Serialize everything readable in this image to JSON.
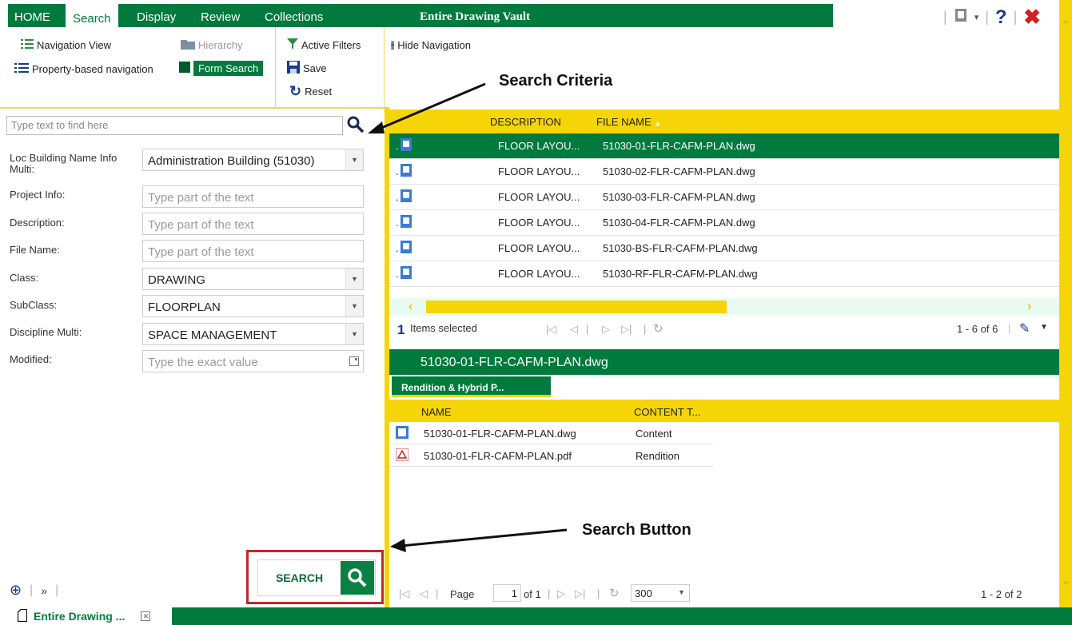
{
  "tabs": [
    "HOME",
    "Search",
    "Display",
    "Review",
    "Collections"
  ],
  "vault_title": "Entire Drawing Vault",
  "ribbon": {
    "navigation_view": "Navigation View",
    "hierarchy": "Hierarchy",
    "property_nav": "Property-based navigation",
    "form_search": "Form Search",
    "active_filters": "Active Filters",
    "save": "Save",
    "reset": "Reset",
    "hide_navigation": "Hide Navigation"
  },
  "search": {
    "placeholder": "Type text to find here",
    "button_label": "SEARCH"
  },
  "form": {
    "loc_label": "Loc Building Name Info Multi:",
    "loc_value": "Administration Building (51030)",
    "project_label": "Project Info:",
    "project_ph": "Type part of the text",
    "description_label": "Description:",
    "description_ph": "Type part of the text",
    "filename_label": "File Name:",
    "filename_ph": "Type part of the text",
    "class_label": "Class:",
    "class_value": "DRAWING",
    "subclass_label": "SubClass:",
    "subclass_value": "FLOORPLAN",
    "discipline_label": "Discipline Multi:",
    "discipline_value": "SPACE MANAGEMENT",
    "modified_label": "Modified:",
    "modified_ph": "Type the exact value"
  },
  "grid": {
    "col_description": "DESCRIPTION",
    "col_filename": "FILE NAME",
    "rows": [
      {
        "desc": "FLOOR LAYOU...",
        "file": "51030-01-FLR-CAFM-PLAN.dwg"
      },
      {
        "desc": "FLOOR LAYOU...",
        "file": "51030-02-FLR-CAFM-PLAN.dwg"
      },
      {
        "desc": "FLOOR LAYOU...",
        "file": "51030-03-FLR-CAFM-PLAN.dwg"
      },
      {
        "desc": "FLOOR LAYOU...",
        "file": "51030-04-FLR-CAFM-PLAN.dwg"
      },
      {
        "desc": "FLOOR LAYOU...",
        "file": "51030-BS-FLR-CAFM-PLAN.dwg"
      },
      {
        "desc": "FLOOR LAYOU...",
        "file": "51030-RF-FLR-CAFM-PLAN.dwg"
      }
    ],
    "selected_count": "1",
    "selected_text": "Items selected",
    "range": "1 - 6 of 6"
  },
  "detail": {
    "title": "51030-01-FLR-CAFM-PLAN.dwg",
    "tab": "Rendition & Hybrid P...",
    "col_name": "NAME",
    "col_content": "CONTENT T...",
    "rows": [
      {
        "name": "51030-01-FLR-CAFM-PLAN.dwg",
        "type": "Content"
      },
      {
        "name": "51030-01-FLR-CAFM-PLAN.pdf",
        "type": "Rendition"
      }
    ]
  },
  "pager": {
    "page_label": "Page",
    "page_value": "1",
    "of_label": "of 1",
    "page_size": "300",
    "range": "1 - 2 of 2"
  },
  "status_tab": "Entire Drawing ...",
  "annotations": {
    "search_criteria": "Search Criteria",
    "search_button": "Search Button"
  },
  "colors": {
    "brand_green": "#007a3d",
    "accent_yellow": "#f6d507",
    "highlight_red": "#c0272d"
  }
}
